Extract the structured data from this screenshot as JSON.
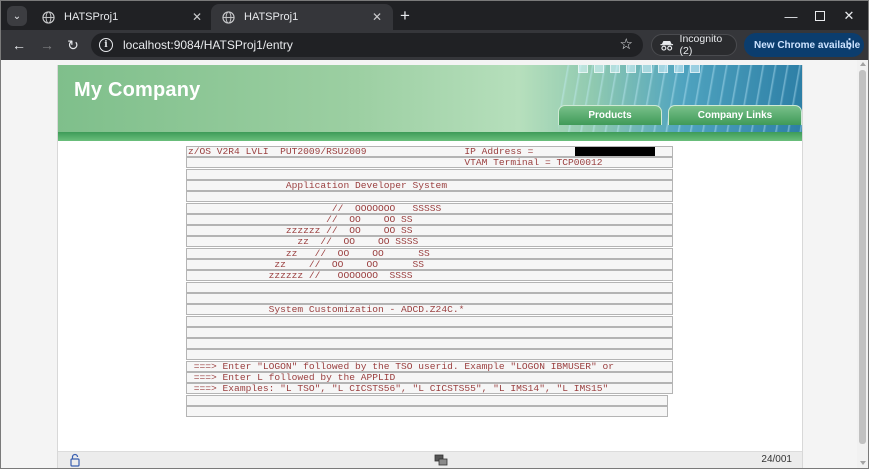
{
  "browser": {
    "tabs": [
      {
        "title": "HATSProj1",
        "active": false
      },
      {
        "title": "HATSProj1",
        "active": true
      }
    ],
    "new_tab_symbol": "+",
    "url": "localhost:9084/HATSProj1/entry",
    "incognito_label": "Incognito (2)",
    "update_label": "New Chrome available"
  },
  "banner": {
    "company": "My Company",
    "nav": [
      "Products",
      "Company Links"
    ]
  },
  "terminal": {
    "rows": [
      {
        "text": "z/OS V2R4 LVLI  PUT2009/RSU2009                 IP Address = "
      },
      {
        "text": "                                                VTAM Terminal = TCP00012"
      },
      {
        "text": ""
      },
      {
        "text": "                 Application Developer System"
      },
      {
        "text": ""
      },
      {
        "text": "                         //  OOOOOOO   SSSSS"
      },
      {
        "text": "                        //  OO    OO SS"
      },
      {
        "text": "                 zzzzzz //  OO    OO SS"
      },
      {
        "text": "                   zz  //  OO    OO SSSS"
      },
      {
        "text": "                 zz   //  OO    OO      SS"
      },
      {
        "text": "               zz    //  OO    OO      SS"
      },
      {
        "text": "              zzzzzz //   OOOOOOO  SSSS"
      },
      {
        "text": ""
      },
      {
        "text": ""
      },
      {
        "text": "              System Customization - ADCD.Z24C.*"
      },
      {
        "text": ""
      },
      {
        "text": ""
      },
      {
        "text": ""
      },
      {
        "text": ""
      },
      {
        "text": " ===> Enter \"LOGON\" followed by the TSO userid. Example \"LOGON IBMUSER\" or"
      },
      {
        "text": " ===> Enter L followed by the APPLID"
      },
      {
        "text": " ===> Examples: \"L TSO\", \"L CICSTS56\", \"L CICSTS55\", \"L IMS14\", \"L IMS15\""
      },
      {
        "text": ""
      },
      {
        "text": ""
      }
    ]
  },
  "status": {
    "cursor_position": "24/001"
  },
  "colors": {
    "terminal_text": "#9a3f3f",
    "banner_green": "#3d9b58",
    "chrome_dark": "#202124",
    "update_blue": "#0b3d6e"
  }
}
